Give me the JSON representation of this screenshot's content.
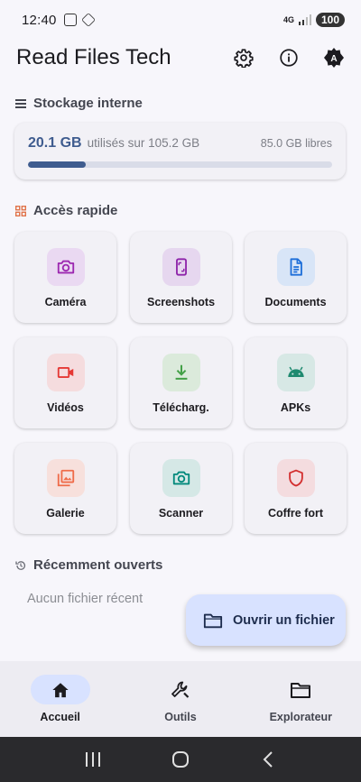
{
  "status_bar": {
    "time": "12:40",
    "network": "4G",
    "battery": "100"
  },
  "header": {
    "title": "Read Files Tech",
    "icons": [
      "settings-icon",
      "info-icon",
      "theme-icon"
    ]
  },
  "storage": {
    "section_title": "Stockage interne",
    "used": "20.1 GB",
    "used_suffix": "utilisés sur 105.2 GB",
    "free": "85.0 GB libres",
    "used_fraction": 0.19,
    "accent": "#3f5c8f"
  },
  "quick_access": {
    "section_title": "Accès rapide",
    "items": [
      {
        "label": "Caméra",
        "icon": "camera-icon",
        "color": "#9c27b0",
        "bg": "#ead9f2"
      },
      {
        "label": "Screenshots",
        "icon": "screenshot-icon",
        "color": "#8e24aa",
        "bg": "#e6d7ef"
      },
      {
        "label": "Documents",
        "icon": "document-icon",
        "color": "#1e6fd9",
        "bg": "#d8e5f7"
      },
      {
        "label": "Vidéos",
        "icon": "video-icon",
        "color": "#e53935",
        "bg": "#f5dcde"
      },
      {
        "label": "Télécharg.",
        "icon": "download-icon",
        "color": "#43a047",
        "bg": "#dbeadb"
      },
      {
        "label": "APKs",
        "icon": "android-icon",
        "color": "#1f8a70",
        "bg": "#d7e8e5"
      },
      {
        "label": "Galerie",
        "icon": "gallery-icon",
        "color": "#ef6c4a",
        "bg": "#f7e0dc"
      },
      {
        "label": "Scanner",
        "icon": "scanner-icon",
        "color": "#00897b",
        "bg": "#d5e8e6"
      },
      {
        "label": "Coffre fort",
        "icon": "shield-icon",
        "color": "#d32f2f",
        "bg": "#f4dcdf"
      }
    ]
  },
  "recent": {
    "section_title": "Récemment ouverts",
    "empty_text": "Aucun fichier récent"
  },
  "fab": {
    "label": "Ouvrir un fichier",
    "icon": "folder-icon"
  },
  "bottom_nav": {
    "items": [
      {
        "label": "Accueil",
        "icon": "home-icon",
        "active": true
      },
      {
        "label": "Outils",
        "icon": "tools-icon",
        "active": false
      },
      {
        "label": "Explorateur",
        "icon": "folder-icon",
        "active": false
      }
    ]
  }
}
